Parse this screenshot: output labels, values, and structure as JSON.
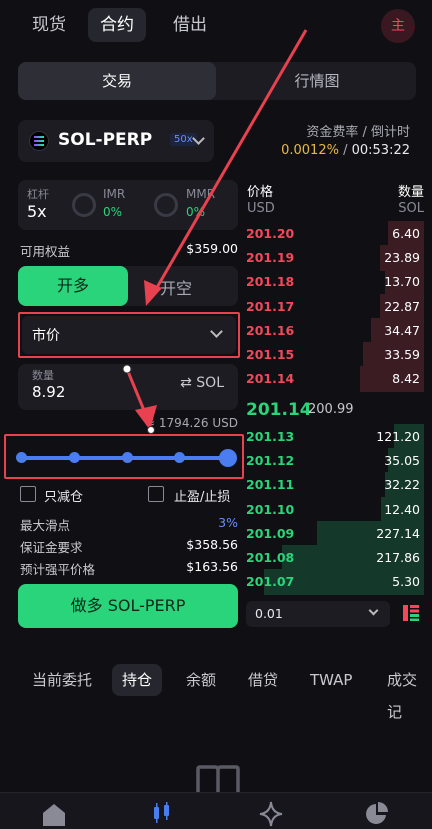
{
  "top_tabs": [
    {
      "label": "现货",
      "active": false
    },
    {
      "label": "合约",
      "active": true
    },
    {
      "label": "借出",
      "active": false
    }
  ],
  "avatar": {
    "label": "主"
  },
  "segment": {
    "trade": "交易",
    "market": "行情图"
  },
  "market": {
    "name": "SOL-PERP",
    "leverage_badge": "50x"
  },
  "funding": {
    "label": "资金费率 / 倒计时",
    "rate": "0.0012%",
    "separator": " / ",
    "countdown": "00:53:22"
  },
  "leverage_box": {
    "leverage_label": "杠杆",
    "leverage_value": "5x",
    "imr_label": "IMR",
    "imr_value": "0%",
    "mmr_label": "MMR",
    "mmr_value": "0%"
  },
  "available_equity": {
    "label": "可用权益",
    "value": "$359.00"
  },
  "side": {
    "long_label": "开多",
    "short_label": "开空"
  },
  "order_type": {
    "value": "市价"
  },
  "amount": {
    "label": "数量",
    "value": "8.92",
    "unit": "⇄ SOL"
  },
  "approx_usd": "≈ 1794.26 USD",
  "slider": {
    "percent": 100
  },
  "options": {
    "reduce_only": "只减仓",
    "tp_sl": "止盈/止损"
  },
  "info_rows": [
    {
      "label": "最大滑点",
      "value": "3%"
    },
    {
      "label": "保证金要求",
      "value": "$358.56"
    },
    {
      "label": "预计强平价格",
      "value": "$163.56"
    }
  ],
  "buy_button": "做多 SOL-PERP",
  "orderbook": {
    "price_header": "价格",
    "price_unit": "USD",
    "qty_header": "数量",
    "qty_unit": "SOL",
    "asks": [
      {
        "price": "201.20",
        "qty": "6.40",
        "depth": 0.2
      },
      {
        "price": "201.19",
        "qty": "23.89",
        "depth": 0.25
      },
      {
        "price": "201.18",
        "qty": "13.70",
        "depth": 0.22
      },
      {
        "price": "201.17",
        "qty": "22.87",
        "depth": 0.25
      },
      {
        "price": "201.16",
        "qty": "34.47",
        "depth": 0.3
      },
      {
        "price": "201.15",
        "qty": "33.59",
        "depth": 0.34
      },
      {
        "price": "201.14",
        "qty": "8.42",
        "depth": 0.36
      }
    ],
    "mid_price": "201.14",
    "mark_price": "200.99",
    "bids": [
      {
        "price": "201.13",
        "qty": "121.20",
        "depth": 0.17
      },
      {
        "price": "201.12",
        "qty": "35.05",
        "depth": 0.2
      },
      {
        "price": "201.11",
        "qty": "32.22",
        "depth": 0.22
      },
      {
        "price": "201.10",
        "qty": "12.40",
        "depth": 0.24
      },
      {
        "price": "201.09",
        "qty": "227.14",
        "depth": 0.6
      },
      {
        "price": "201.08",
        "qty": "217.86",
        "depth": 0.8
      },
      {
        "price": "201.07",
        "qty": "5.30",
        "depth": 0.9
      }
    ],
    "tick_size": "0.01"
  },
  "bottom_tabs": [
    {
      "label": "当前委托",
      "active": false
    },
    {
      "label": "持仓",
      "active": true
    },
    {
      "label": "余额",
      "active": false
    },
    {
      "label": "借贷",
      "active": false
    },
    {
      "label": "TWAP",
      "active": false
    },
    {
      "label": "成交记",
      "active": false
    }
  ],
  "nav": [
    "home-icon",
    "candlestick-icon",
    "sparkle-icon",
    "pie-chart-icon"
  ],
  "colors": {
    "green": "#2ad47a",
    "red": "#f04a5a",
    "accent": "#4a7df0",
    "annotation": "#e8414f"
  }
}
